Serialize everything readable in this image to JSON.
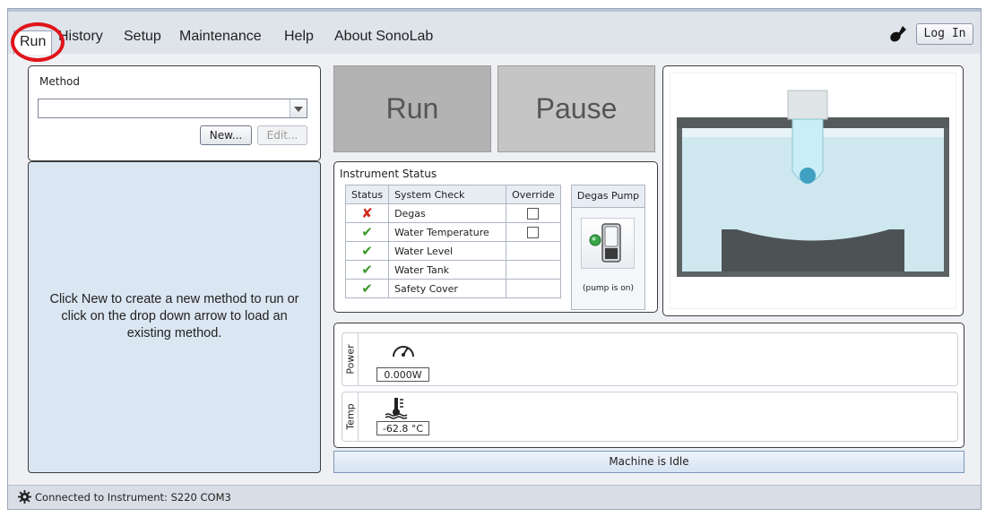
{
  "menu": {
    "items": [
      "Run",
      "History",
      "Setup",
      "Maintenance",
      "Help",
      "About SonoLab"
    ],
    "login_label": "Log In"
  },
  "method": {
    "label": "Method",
    "selected_value": "",
    "new_label": "New...",
    "edit_label": "Edit..."
  },
  "info": {
    "message_line1": "Click New to create a new method to run or",
    "message_line2": "click on the drop down arrow to load an",
    "message_line3": "existing method."
  },
  "controls": {
    "run_label": "Run",
    "pause_label": "Pause"
  },
  "instrument_status": {
    "title": "Instrument Status",
    "columns": [
      "Status",
      "System Check",
      "Override"
    ],
    "rows": [
      {
        "status": "fail",
        "check": "Degas",
        "override": true
      },
      {
        "status": "ok",
        "check": "Water Temperature",
        "override": true
      },
      {
        "status": "ok",
        "check": "Water Level",
        "override": false
      },
      {
        "status": "ok",
        "check": "Water Tank",
        "override": false
      },
      {
        "status": "ok",
        "check": "Safety Cover",
        "override": false
      }
    ],
    "degas_title": "Degas Pump",
    "degas_caption": "(pump is on)"
  },
  "meters": {
    "power_label": "Power",
    "power_value": "0.000W",
    "temp_label": "Temp",
    "temp_value": "-62.8 °C"
  },
  "machine_status": "Machine is Idle",
  "statusbar": {
    "text": "Connected to Instrument: S220 COM3"
  },
  "colors": {
    "annotation_red": "#e0141a",
    "fail": "#d22a1a",
    "ok": "#3a9a2a",
    "water": "#cfe8f0"
  },
  "icons": [
    "key-icon",
    "gauge-icon",
    "thermometer-icon",
    "gear-icon",
    "dropdown-arrow-icon",
    "toggle-switch-icon"
  ]
}
